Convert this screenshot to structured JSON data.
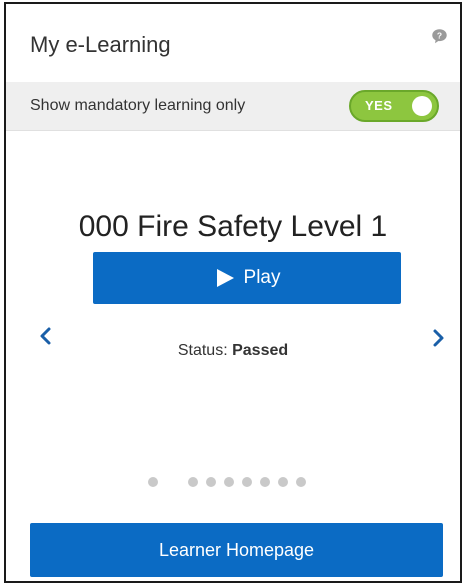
{
  "widget": {
    "title": "My e-Learning",
    "help_icon": "help-bubble-icon"
  },
  "filter": {
    "label": "Show mandatory learning only",
    "toggle_state": "YES",
    "toggle_color": "#8dc63f"
  },
  "course": {
    "title": "000 Fire Safety Level 1",
    "play_label": "Play",
    "status_label": "Status:",
    "status_value": "Passed"
  },
  "carousel": {
    "prev_icon": "chevron-left-icon",
    "next_icon": "chevron-right-icon",
    "arrow_color": "#1a5fa8",
    "page_count": 8,
    "active_page": 1
  },
  "footer": {
    "button_label": "Learner Homepage"
  },
  "colors": {
    "primary": "#0b6bc4",
    "border": "#1a1a1a"
  }
}
